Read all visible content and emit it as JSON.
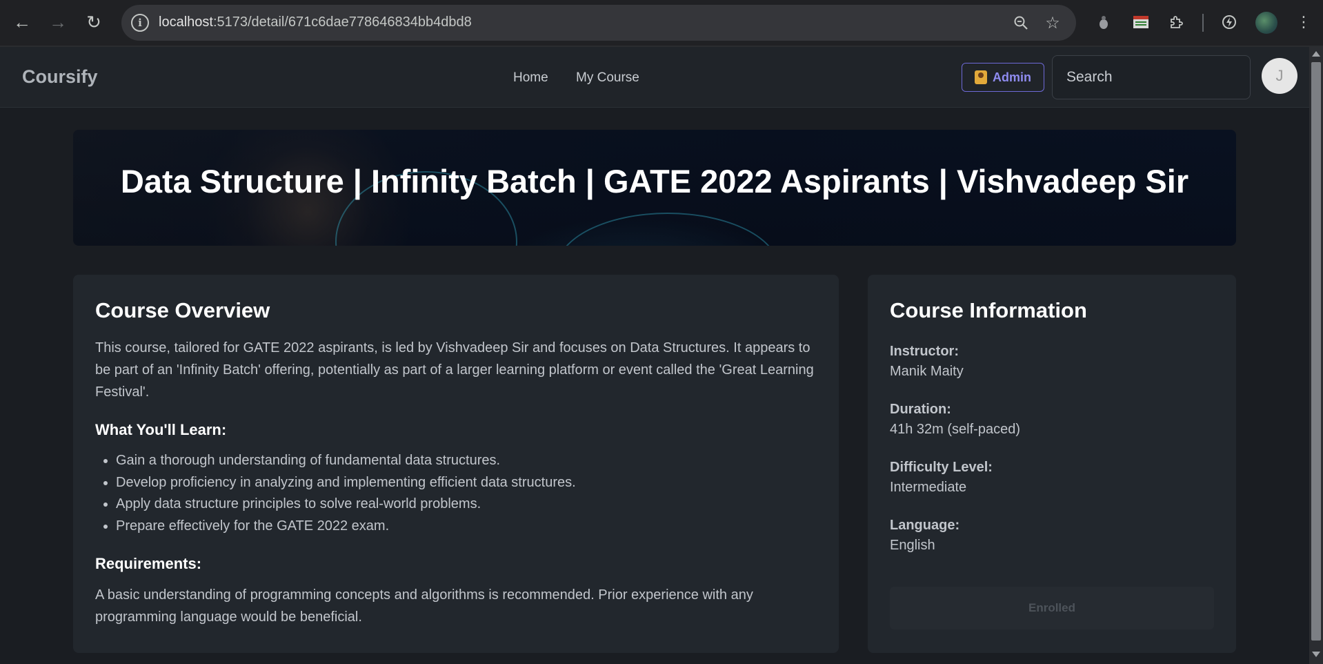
{
  "browser": {
    "url_host": "localhost",
    "url_path": ":5173/detail/671c6dae778646834bb4dbd8"
  },
  "header": {
    "brand": "Coursify",
    "nav": [
      "Home",
      "My Course"
    ],
    "admin_label": "Admin",
    "search_placeholder": "Search",
    "avatar_initial": "J"
  },
  "hero": {
    "title": "Data Structure | Infinity Batch | GATE 2022 Aspirants | Vishvadeep Sir"
  },
  "overview": {
    "heading": "Course Overview",
    "description": "This course, tailored for GATE 2022 aspirants, is led by Vishvadeep Sir and focuses on Data Structures. It appears to be part of an 'Infinity Batch' offering, potentially as part of a larger learning platform or event called the 'Great Learning Festival'.",
    "learn_heading": "What You'll Learn:",
    "learn_items": [
      "Gain a thorough understanding of fundamental data structures.",
      "Develop proficiency in analyzing and implementing efficient data structures.",
      "Apply data structure principles to solve real-world problems.",
      "Prepare effectively for the GATE 2022 exam."
    ],
    "requirements_heading": "Requirements:",
    "requirements": "A basic understanding of programming concepts and algorithms is recommended. Prior experience with any programming language would be beneficial."
  },
  "info": {
    "heading": "Course Information",
    "fields": [
      {
        "label": "Instructor:",
        "value": "Manik Maity"
      },
      {
        "label": "Duration:",
        "value": "41h 32m (self-paced)"
      },
      {
        "label": "Difficulty Level:",
        "value": "Intermediate"
      },
      {
        "label": "Language:",
        "value": "English"
      }
    ],
    "enroll_label": "Enrolled"
  },
  "colors": {
    "page_bg": "#1a1d22",
    "card_bg": "#22272d",
    "accent": "#6e6ad8"
  }
}
